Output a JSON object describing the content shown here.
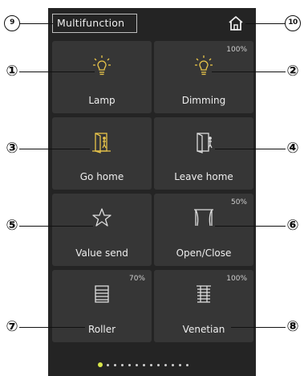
{
  "header": {
    "title": "Multifunction",
    "home_icon": "home-icon"
  },
  "tiles": [
    {
      "label": "Lamp",
      "value": "",
      "icon": "lightbulb-icon"
    },
    {
      "label": "Dimming",
      "value": "100%",
      "icon": "lightbulb-icon"
    },
    {
      "label": "Go home",
      "value": "",
      "icon": "door-enter-icon"
    },
    {
      "label": "Leave home",
      "value": "",
      "icon": "door-exit-icon"
    },
    {
      "label": "Value send",
      "value": "",
      "icon": "star-icon"
    },
    {
      "label": "Open/Close",
      "value": "50%",
      "icon": "curtain-icon"
    },
    {
      "label": "Roller",
      "value": "70%",
      "icon": "roller-shutter-icon"
    },
    {
      "label": "Venetian",
      "value": "100%",
      "icon": "venetian-blind-icon"
    }
  ],
  "callouts": [
    "①",
    "②",
    "③",
    "④",
    "⑤",
    "⑥",
    "⑦",
    "⑧",
    "9",
    "10"
  ],
  "pagination": {
    "total": 13,
    "active": 0
  },
  "colors": {
    "panel": "#242424",
    "tile": "#363636",
    "accent": "#e8c44a",
    "active_dot": "#d8e64a"
  }
}
